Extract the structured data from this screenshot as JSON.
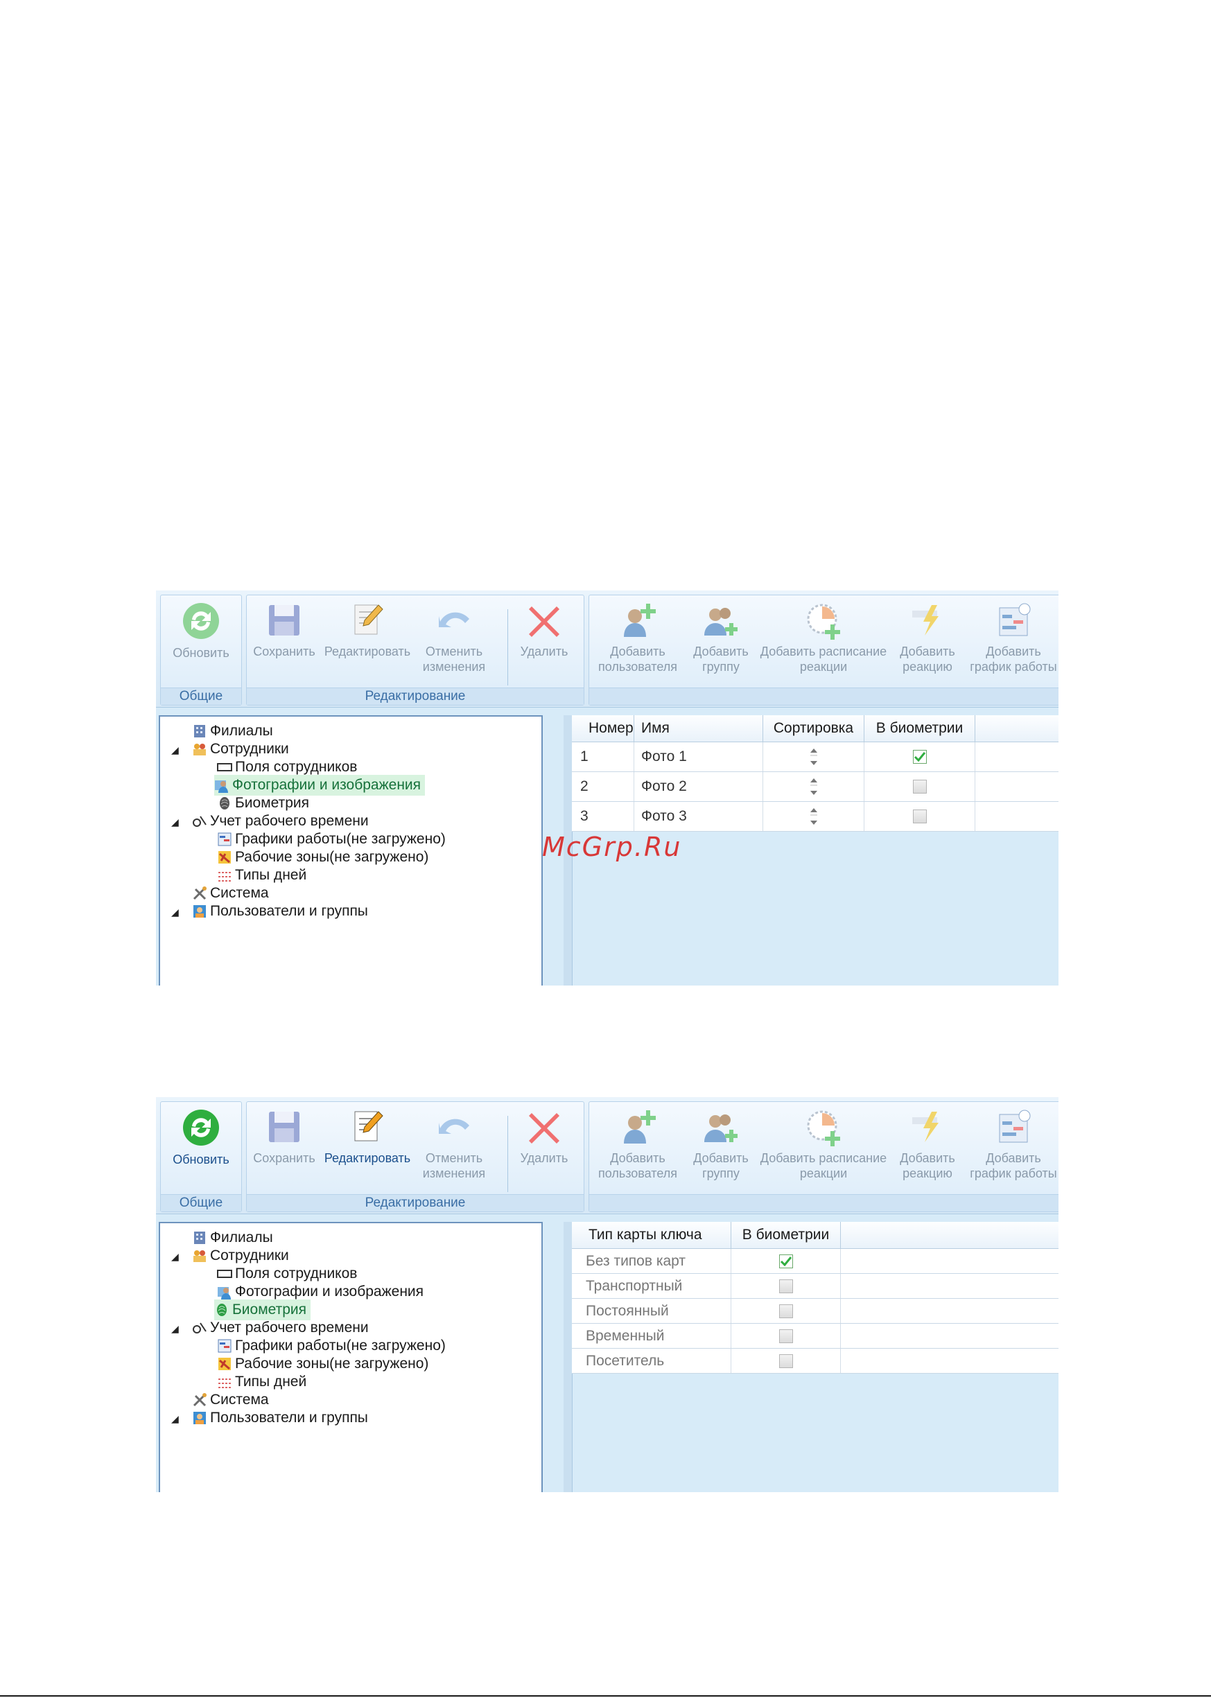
{
  "watermark": "McGrp.Ru",
  "ribbon": {
    "refresh": "Обновить",
    "save": "Сохранить",
    "edit": "Редактировать",
    "undo": "Отменить изменения",
    "delete": "Удалить",
    "add_user": "Добавить пользователя",
    "add_group": "Добавить группу",
    "add_schedule": "Добавить расписание реакции",
    "add_reaction": "Добавить реакцию",
    "add_work_schedule": "Добавить график работы",
    "group_general": "Общие",
    "group_editing": "Редактирование"
  },
  "tree": {
    "branches": "Филиалы",
    "employees": "Сотрудники",
    "employee_fields": "Поля сотрудников",
    "photos": "Фотографии и изображения",
    "biometrics": "Биометрия",
    "time_tracking": "Учет рабочего времени",
    "work_schedules": "Графики работы(не загружено)",
    "work_zones": "Рабочие зоны(не загружено)",
    "day_types": "Типы дней",
    "system": "Система",
    "users_groups": "Пользователи и группы"
  },
  "screen1": {
    "selected_node": "photos",
    "columns": [
      "Номер",
      "Имя",
      "Сортировка",
      "В биометрии"
    ],
    "rows": [
      {
        "num": "1",
        "name": "Фото 1",
        "in_bio": true
      },
      {
        "num": "2",
        "name": "Фото 2",
        "in_bio": false
      },
      {
        "num": "3",
        "name": "Фото 3",
        "in_bio": false
      }
    ]
  },
  "screen2": {
    "selected_node": "biometrics",
    "columns": [
      "Тип карты ключа",
      "В биометрии"
    ],
    "rows": [
      {
        "type": "Без типов карт",
        "in_bio": true
      },
      {
        "type": "Транспортный",
        "in_bio": false
      },
      {
        "type": "Постоянный",
        "in_bio": false
      },
      {
        "type": "Временный",
        "in_bio": false
      },
      {
        "type": "Посетитель",
        "in_bio": false
      }
    ]
  },
  "colors": {
    "accent_green": "#2fae3f",
    "selection_bg": "#d8f3df",
    "ribbon_text_on": "#1b4f8c",
    "disabled_text": "#8a9aaa"
  }
}
